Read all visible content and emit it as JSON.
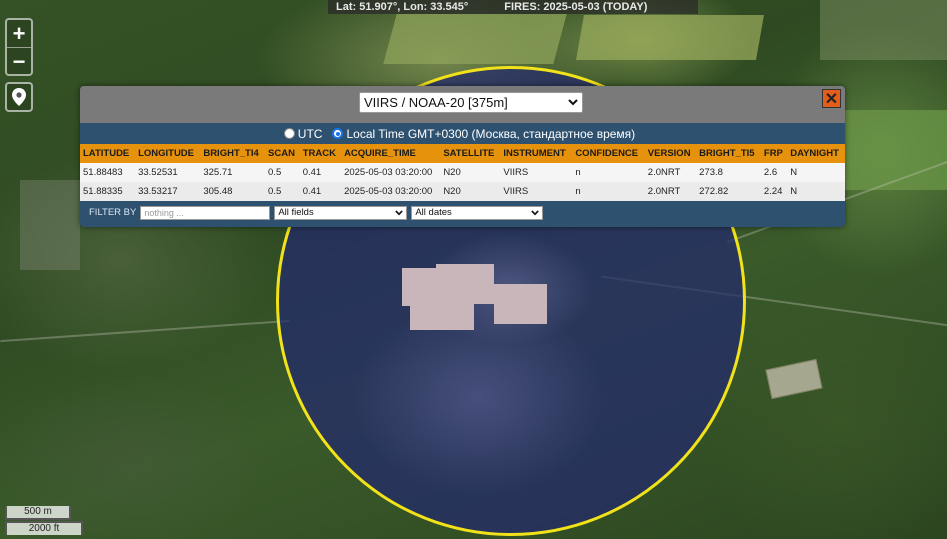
{
  "statusbar": {
    "coords": "Lat: 51.907°, Lon: 33.545°",
    "fires": "FIRES: 2025-05-03 (TODAY)"
  },
  "map_controls": {
    "zoom_in": "+",
    "zoom_out": "−"
  },
  "scale": {
    "metric": "500 m",
    "imperial": "2000 ft"
  },
  "popup": {
    "satellite_select": "VIIRS / NOAA-20 [375m]",
    "close": "✕",
    "time_options": {
      "utc": "UTC",
      "local": "Local Time GMT+0300 (Москва, стандартное время)",
      "selected": "local"
    },
    "columns": [
      "LATITUDE",
      "LONGITUDE",
      "BRIGHT_TI4",
      "SCAN",
      "TRACK",
      "ACQUIRE_TIME",
      "SATELLITE",
      "INSTRUMENT",
      "CONFIDENCE",
      "VERSION",
      "BRIGHT_TI5",
      "FRP",
      "DAYNIGHT"
    ],
    "rows": [
      [
        "51.88483",
        "33.52531",
        "325.71",
        "0.5",
        "0.41",
        "2025-05-03 03:20:00",
        "N20",
        "VIIRS",
        "n",
        "2.0NRT",
        "273.8",
        "2.6",
        "N"
      ],
      [
        "51.88335",
        "33.53217",
        "305.48",
        "0.5",
        "0.41",
        "2025-05-03 03:20:00",
        "N20",
        "VIIRS",
        "n",
        "2.0NRT",
        "272.82",
        "2.24",
        "N"
      ]
    ],
    "filter": {
      "label": "FILTER BY",
      "placeholder": "nothing ...",
      "field_select": "All fields",
      "date_select": "All dates"
    }
  },
  "colors": {
    "popup_bg": "#2e5170",
    "table_header": "#e6920c",
    "close_button": "#e35d1b",
    "fire_circle_border": "#f2e21a"
  }
}
